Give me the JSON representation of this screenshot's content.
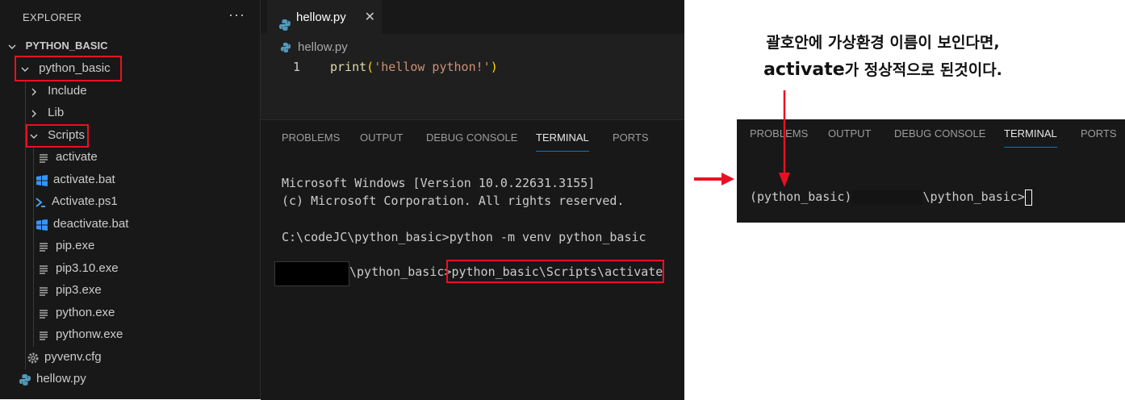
{
  "explorer": {
    "header": "EXPLORER",
    "more": "···",
    "root": "PYTHON_BASIC",
    "items": [
      {
        "label": "python_basic",
        "type": "folder-open",
        "icon": "chevron-down-icon"
      },
      {
        "label": "Include",
        "type": "folder",
        "icon": "chevron-right-icon"
      },
      {
        "label": "Lib",
        "type": "folder",
        "icon": "chevron-right-icon"
      },
      {
        "label": "Scripts",
        "type": "folder-open",
        "icon": "chevron-down-icon"
      },
      {
        "label": "activate",
        "type": "file",
        "icon": "text-file-icon"
      },
      {
        "label": "activate.bat",
        "type": "file",
        "icon": "windows-icon"
      },
      {
        "label": "Activate.ps1",
        "type": "file",
        "icon": "powershell-icon"
      },
      {
        "label": "deactivate.bat",
        "type": "file",
        "icon": "windows-icon"
      },
      {
        "label": "pip.exe",
        "type": "file",
        "icon": "text-file-icon"
      },
      {
        "label": "pip3.10.exe",
        "type": "file",
        "icon": "text-file-icon"
      },
      {
        "label": "pip3.exe",
        "type": "file",
        "icon": "text-file-icon"
      },
      {
        "label": "python.exe",
        "type": "file",
        "icon": "text-file-icon"
      },
      {
        "label": "pythonw.exe",
        "type": "file",
        "icon": "text-file-icon"
      },
      {
        "label": "pyvenv.cfg",
        "type": "file",
        "icon": "gear-icon"
      },
      {
        "label": "hellow.py",
        "type": "file",
        "icon": "python-icon"
      }
    ]
  },
  "editor": {
    "tab_label": "hellow.py",
    "tab_close": "✕",
    "breadcrumb": "hellow.py",
    "line_number": "1",
    "code": {
      "fn": "print",
      "open": "(",
      "str": "'hellow python!'",
      "close": ")"
    }
  },
  "panel": {
    "tabs": [
      "PROBLEMS",
      "OUTPUT",
      "DEBUG CONSOLE",
      "TERMINAL",
      "PORTS"
    ],
    "active_tab": "TERMINAL",
    "terminal": {
      "line1": "Microsoft Windows [Version 10.0.22631.3155]",
      "line2": "(c) Microsoft Corporation. All rights reserved.",
      "line3": "C:\\codeJC\\python_basic>python -m venv python_basic",
      "line4_prompt": "\\python_basic>",
      "line4_cmd": "python_basic\\Scripts\\activate"
    }
  },
  "annotation": {
    "line1": "괄호안에 가상환경 이름이 보인다면,",
    "line2_bold": "activate",
    "line2_rest": "가 정상적으로 된것이다."
  },
  "result_panel": {
    "tabs": [
      "PROBLEMS",
      "OUTPUT",
      "DEBUG CONSOLE",
      "TERMINAL",
      "PORTS"
    ],
    "active_tab": "TERMINAL",
    "env_name": "(python_basic)",
    "prompt": "\\python_basic>"
  },
  "colors": {
    "highlight": "#e81123",
    "accent": "#0078d4"
  }
}
